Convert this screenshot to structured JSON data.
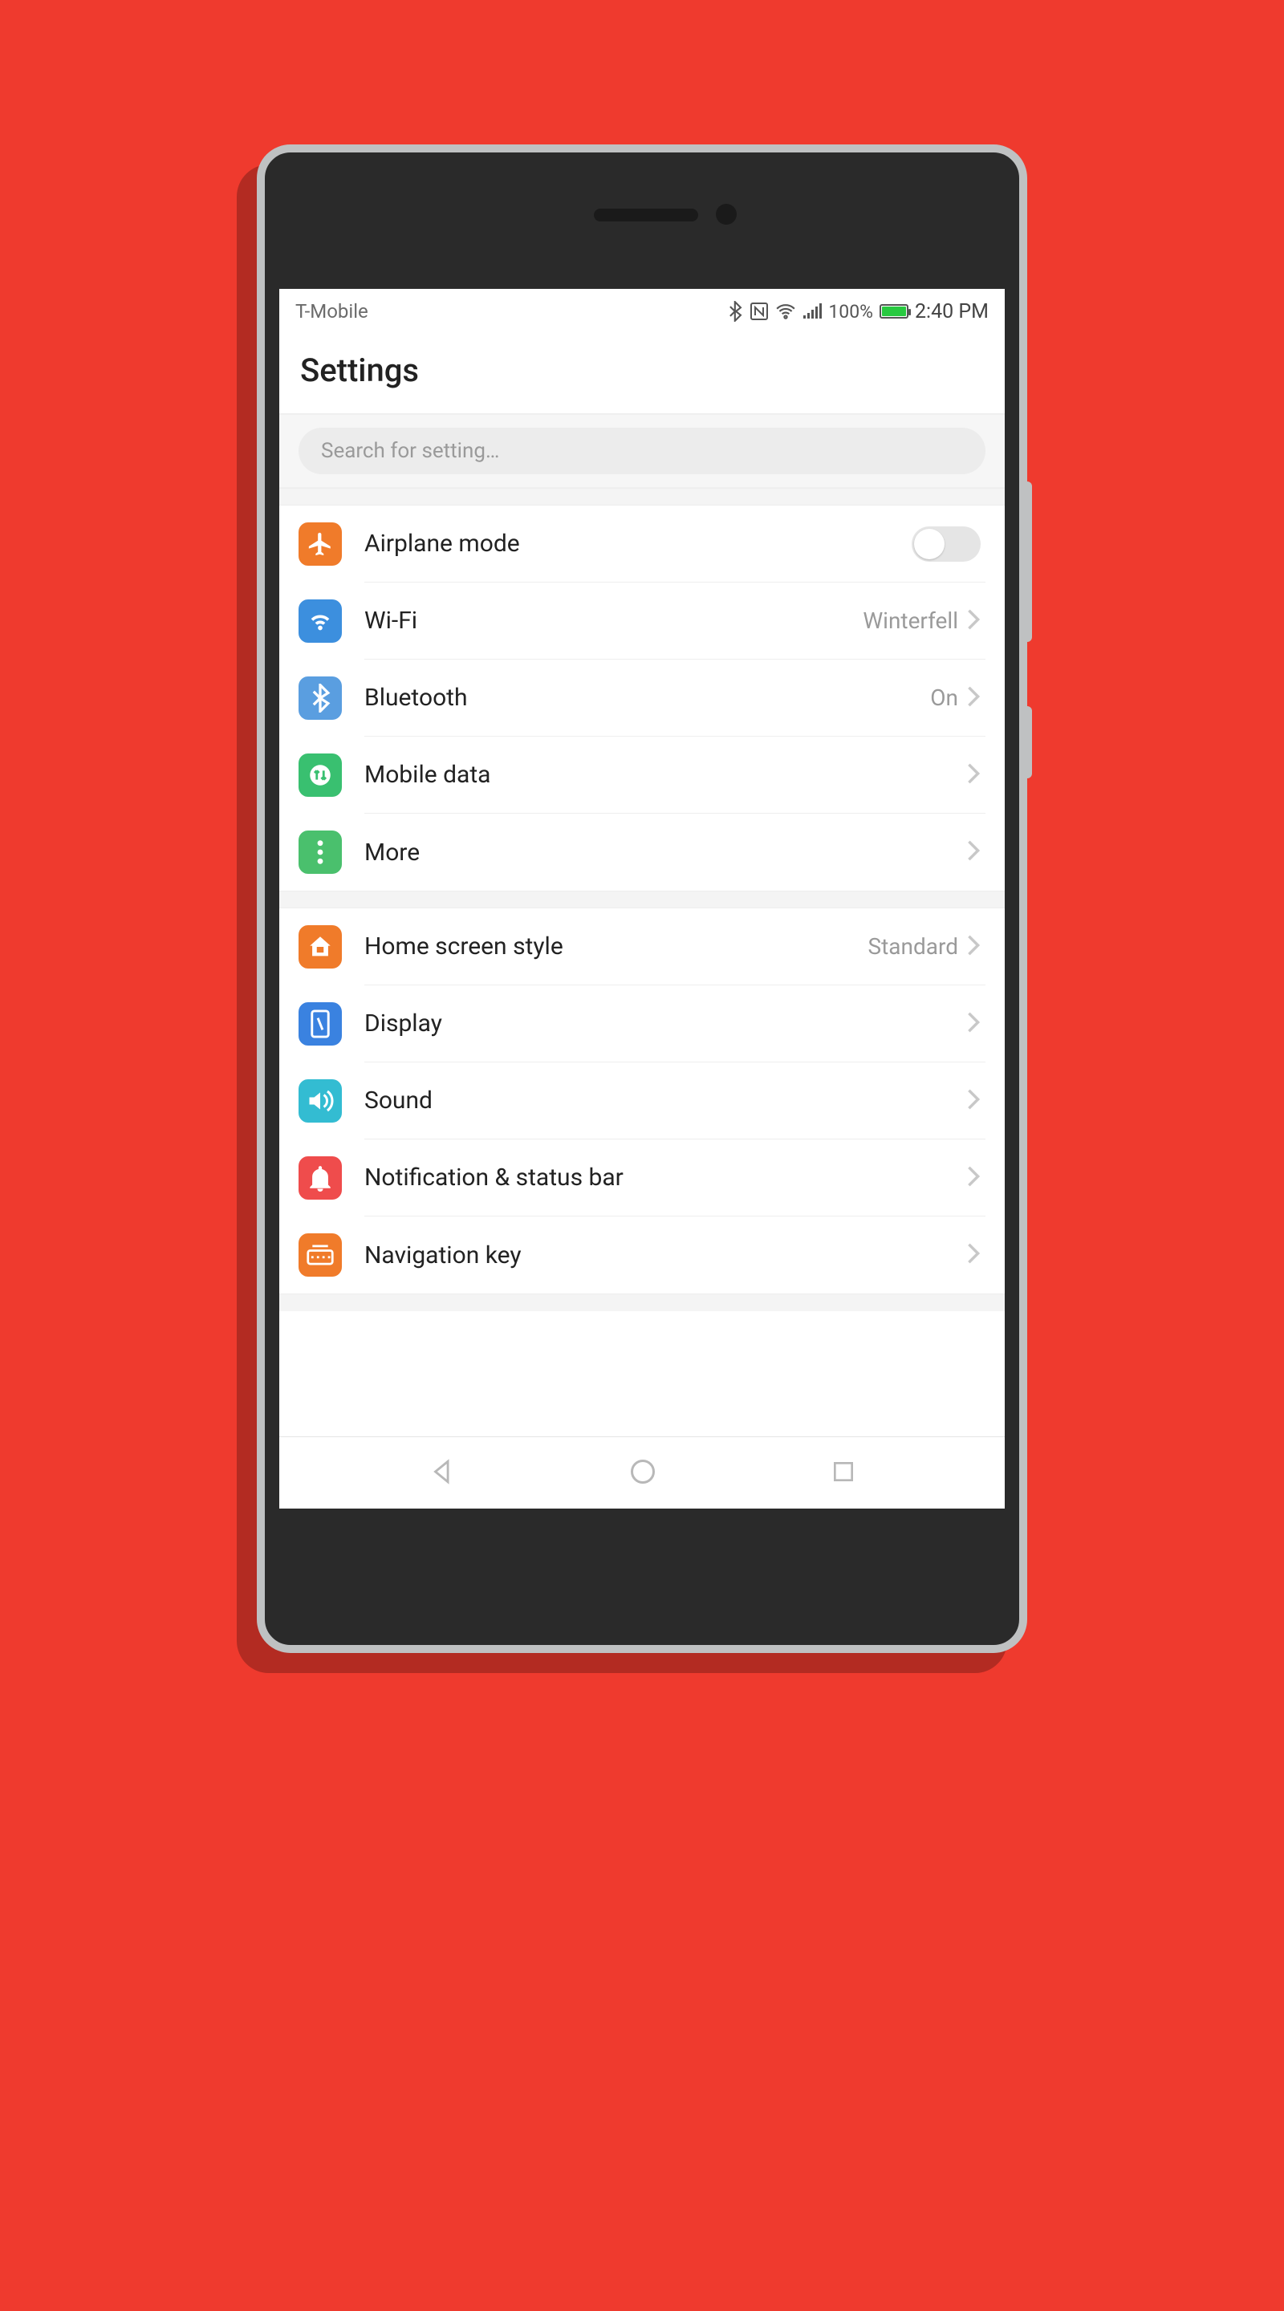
{
  "statusbar": {
    "carrier": "T-Mobile",
    "battery_pct": "100%",
    "time": "2:40 PM"
  },
  "header": {
    "title": "Settings"
  },
  "search": {
    "placeholder": "Search for setting…"
  },
  "groups": [
    {
      "items": [
        {
          "icon": "airplane",
          "label": "Airplane mode",
          "control": "toggle",
          "toggle_on": false
        },
        {
          "icon": "wifi",
          "label": "Wi-Fi",
          "value": "Winterfell",
          "control": "chevron"
        },
        {
          "icon": "bluetooth",
          "label": "Bluetooth",
          "value": "On",
          "control": "chevron"
        },
        {
          "icon": "mobiledata",
          "label": "Mobile data",
          "control": "chevron"
        },
        {
          "icon": "more",
          "label": "More",
          "control": "chevron"
        }
      ]
    },
    {
      "items": [
        {
          "icon": "home",
          "label": "Home screen style",
          "value": "Standard",
          "control": "chevron"
        },
        {
          "icon": "display",
          "label": "Display",
          "control": "chevron"
        },
        {
          "icon": "sound",
          "label": "Sound",
          "control": "chevron"
        },
        {
          "icon": "notification",
          "label": "Notification & status bar",
          "control": "chevron"
        },
        {
          "icon": "navkey",
          "label": "Navigation key",
          "control": "chevron"
        }
      ]
    }
  ]
}
